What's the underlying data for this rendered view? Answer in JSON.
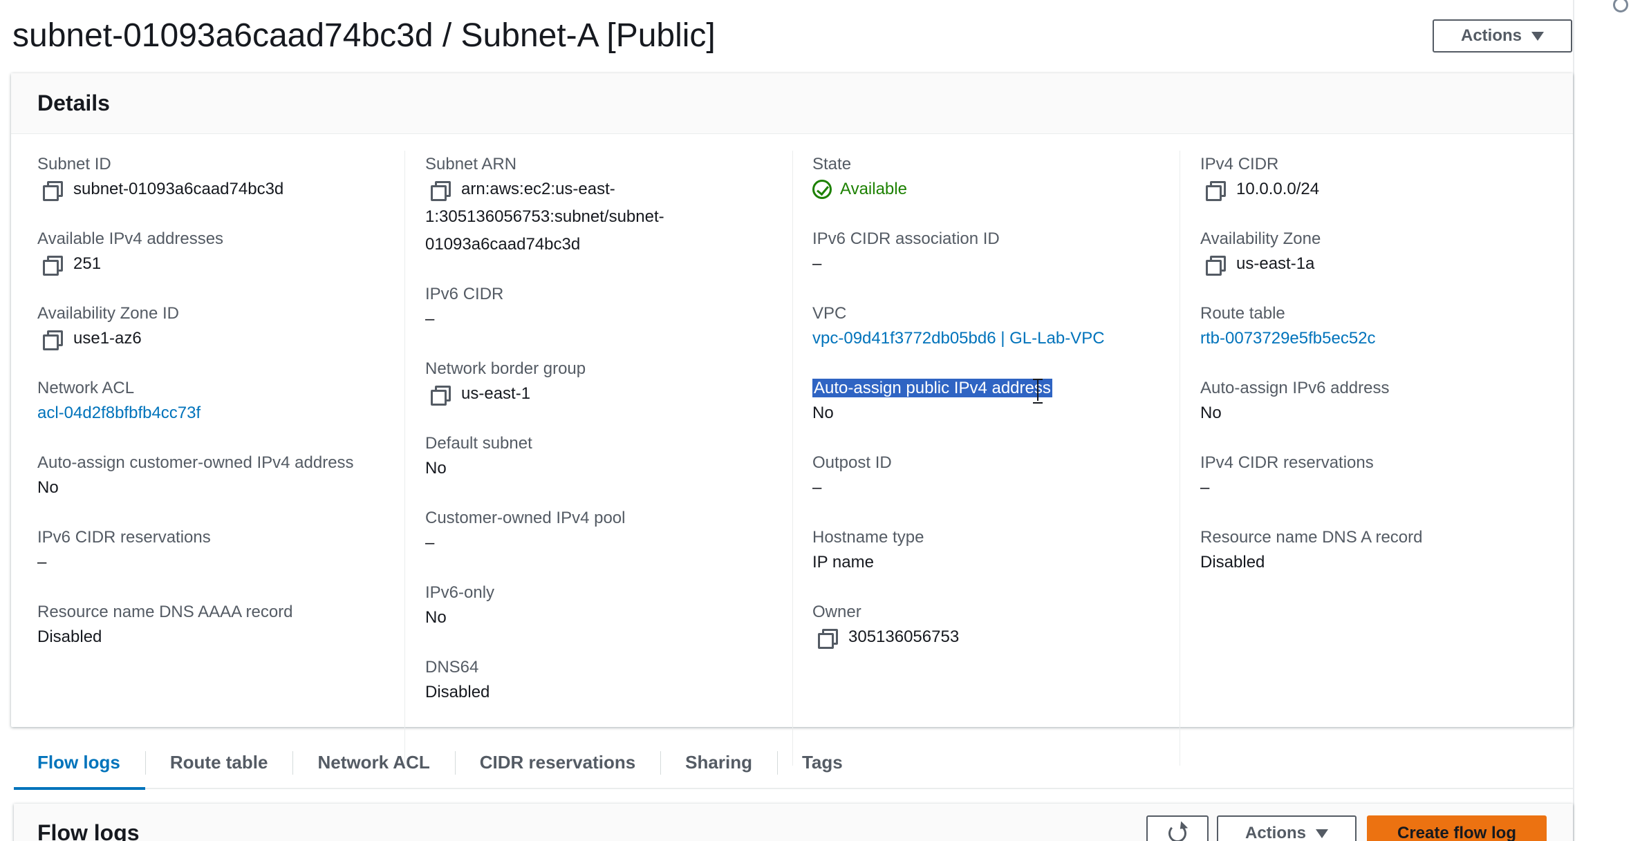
{
  "header": {
    "title": "subnet-01093a6caad74bc3d / Subnet-A [Public]",
    "actions_label": "Actions"
  },
  "details": {
    "title": "Details",
    "col1": {
      "subnet_id_label": "Subnet ID",
      "subnet_id_value": "subnet-01093a6caad74bc3d",
      "available_ipv4_label": "Available IPv4 addresses",
      "available_ipv4_value": "251",
      "az_id_label": "Availability Zone ID",
      "az_id_value": "use1-az6",
      "network_acl_label": "Network ACL",
      "network_acl_value": "acl-04d2f8bfbfb4cc73f",
      "customer_owned_label": "Auto-assign customer-owned IPv4 address",
      "customer_owned_value": "No",
      "ipv6_reservations_label": "IPv6 CIDR reservations",
      "ipv6_reservations_value": "–",
      "dns_aaaa_label": "Resource name DNS AAAA record",
      "dns_aaaa_value": "Disabled"
    },
    "col2": {
      "subnet_arn_label": "Subnet ARN",
      "subnet_arn_line1": "arn:aws:ec2:us-east-",
      "subnet_arn_line2": "1:305136056753:subnet/subnet-",
      "subnet_arn_line3": "01093a6caad74bc3d",
      "ipv6_cidr_label": "IPv6 CIDR",
      "ipv6_cidr_value": "–",
      "border_group_label": "Network border group",
      "border_group_value": "us-east-1",
      "default_subnet_label": "Default subnet",
      "default_subnet_value": "No",
      "customer_pool_label": "Customer-owned IPv4 pool",
      "customer_pool_value": "–",
      "ipv6_only_label": "IPv6-only",
      "ipv6_only_value": "No",
      "dns64_label": "DNS64",
      "dns64_value": "Disabled"
    },
    "col3": {
      "state_label": "State",
      "state_value": "Available",
      "ipv6_assoc_label": "IPv6 CIDR association ID",
      "ipv6_assoc_value": "–",
      "vpc_label": "VPC",
      "vpc_value": "vpc-09d41f3772db05bd6 | GL-Lab-VPC",
      "auto_assign_ipv4_label": "Auto-assign public IPv4 address",
      "auto_assign_ipv4_value": "No",
      "outpost_label": "Outpost ID",
      "outpost_value": "–",
      "hostname_label": "Hostname type",
      "hostname_value": "IP name",
      "owner_label": "Owner",
      "owner_value": "305136056753"
    },
    "col4": {
      "ipv4_cidr_label": "IPv4 CIDR",
      "ipv4_cidr_value": "10.0.0.0/24",
      "az_label": "Availability Zone",
      "az_value": "us-east-1a",
      "route_table_label": "Route table",
      "route_table_value": "rtb-0073729e5fb5ec52c",
      "auto_assign_ipv6_label": "Auto-assign IPv6 address",
      "auto_assign_ipv6_value": "No",
      "ipv4_reservations_label": "IPv4 CIDR reservations",
      "ipv4_reservations_value": "–",
      "dns_a_label": "Resource name DNS A record",
      "dns_a_value": "Disabled"
    }
  },
  "tabs": [
    {
      "label": "Flow logs",
      "active": true
    },
    {
      "label": "Route table",
      "active": false
    },
    {
      "label": "Network ACL",
      "active": false
    },
    {
      "label": "CIDR reservations",
      "active": false
    },
    {
      "label": "Sharing",
      "active": false
    },
    {
      "label": "Tags",
      "active": false
    }
  ],
  "flow_logs": {
    "title": "Flow logs",
    "actions_label": "Actions",
    "create_label": "Create flow log"
  },
  "icons": {
    "copy": "copy-icon",
    "status_ok": "check-circle-icon",
    "refresh": "refresh-icon",
    "caret": "caret-down-icon",
    "text_cursor": "text-cursor-icon"
  },
  "colors": {
    "link": "#0073bb",
    "success": "#1d8102",
    "primary_button": "#ec7211",
    "selection": "#2f64c3",
    "label": "#545b64",
    "text": "#16191f"
  }
}
